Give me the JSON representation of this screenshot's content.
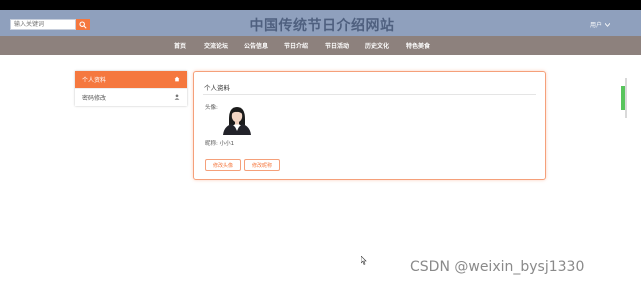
{
  "header": {
    "search_placeholder": "输入关键词",
    "site_title": "中国传统节日介绍网站",
    "user_label": "用户"
  },
  "nav": {
    "items": [
      "首页",
      "交流论坛",
      "公告信息",
      "节日介绍",
      "节日活动",
      "历史文化",
      "特色美食"
    ]
  },
  "sidebar": {
    "items": [
      {
        "label": "个人资料",
        "active": true
      },
      {
        "label": "密码修改",
        "active": false
      }
    ]
  },
  "profile": {
    "title": "个人资料",
    "avatar_label": "头像:",
    "nickname_label": "昵称:",
    "nickname_value": "小小1",
    "btn_change_avatar": "修改头像",
    "btn_change_nickname": "修改昵称"
  },
  "watermark": "CSDN @weixin_bysj1330",
  "colors": {
    "accent": "#f5783f",
    "header_bg": "#8fa0bd",
    "nav_bg": "#8d817d"
  }
}
